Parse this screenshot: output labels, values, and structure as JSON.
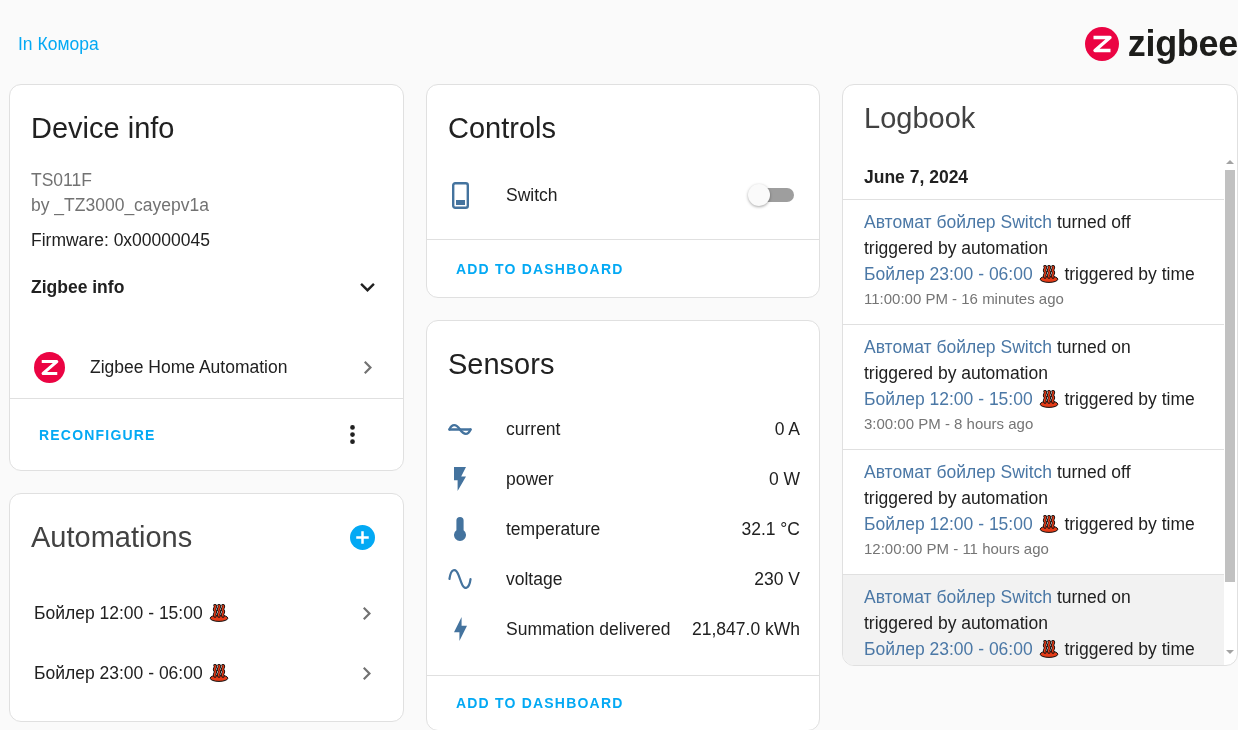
{
  "header": {
    "area_link": "In Комора",
    "logo_text": "zigbee"
  },
  "device_info": {
    "title": "Device info",
    "model": "TS011F",
    "manufacturer": "by _TZ3000_cayepv1a",
    "firmware": "Firmware: 0x00000045",
    "zigbee_info": {
      "label": "Zigbee info",
      "expanded": false
    },
    "integration": "Zigbee Home Automation",
    "action": "RECONFIGURE"
  },
  "automations": {
    "title": "Automations",
    "items": [
      "Бойлер 12:00 - 15:00",
      "Бойлер 23:00 - 06:00"
    ]
  },
  "controls": {
    "title": "Controls",
    "items": [
      {
        "name": "Switch",
        "on": false
      }
    ],
    "action": "ADD TO DASHBOARD"
  },
  "sensors": {
    "title": "Sensors",
    "items": [
      {
        "kind": "current",
        "name": "current",
        "value": "0 A"
      },
      {
        "kind": "power",
        "name": "power",
        "value": "0 W"
      },
      {
        "kind": "temperature",
        "name": "temperature",
        "value": "32.1 °C"
      },
      {
        "kind": "voltage",
        "name": "voltage",
        "value": "230 V"
      },
      {
        "kind": "energy",
        "name": "Summation delivered",
        "value": "21,847.0 kWh"
      }
    ],
    "action": "ADD TO DASHBOARD"
  },
  "logbook": {
    "title": "Logbook",
    "date": "June 7, 2024",
    "entries": [
      {
        "entity": "Автомат бойлер Switch",
        "action": "turned off",
        "trigger": "triggered by automation",
        "source": "Бойлер 23:00 - 06:00",
        "source_trigger": "triggered by time",
        "time": "11:00:00 PM - 16 minutes ago",
        "hovered": false
      },
      {
        "entity": "Автомат бойлер Switch",
        "action": "turned on",
        "trigger": "triggered by automation",
        "source": "Бойлер 12:00 - 15:00",
        "source_trigger": "triggered by time",
        "time": "3:00:00 PM - 8 hours ago",
        "hovered": false
      },
      {
        "entity": "Автомат бойлер Switch",
        "action": "turned off",
        "trigger": "triggered by automation",
        "source": "Бойлер 12:00 - 15:00",
        "source_trigger": "triggered by time",
        "time": "12:00:00 PM - 11 hours ago",
        "hovered": false
      },
      {
        "entity": "Автомат бойлер Switch",
        "action": "turned on",
        "trigger": "triggered by automation",
        "source": "Бойлер 23:00 - 06:00",
        "source_trigger": "triggered by time",
        "hovered": true
      }
    ]
  }
}
